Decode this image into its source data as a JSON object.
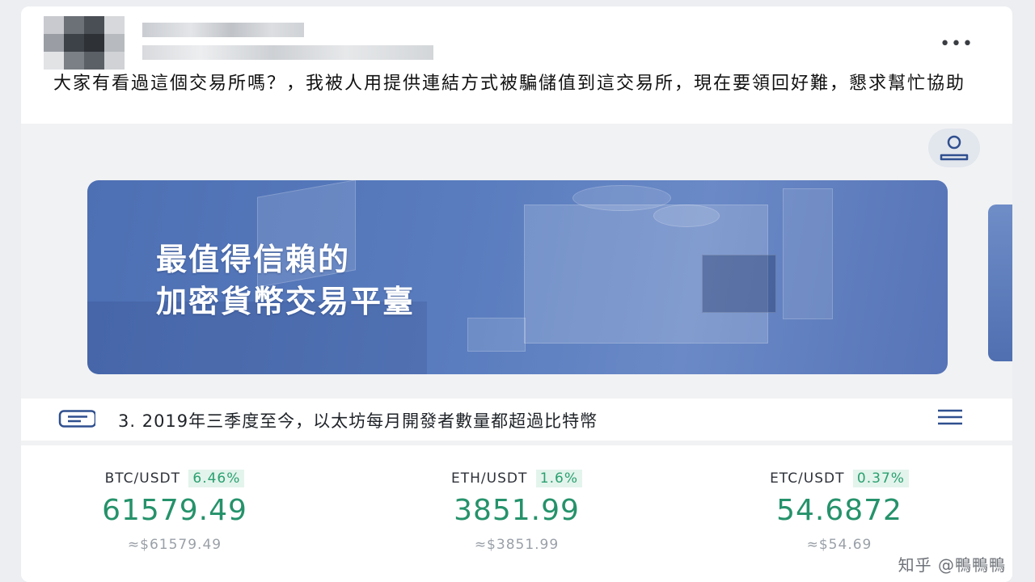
{
  "post": {
    "text": "大家有看過這個交易所嗎？，我被人用提供連結方式被騙儲值到這交易所，現在要領回好難，懇求幫忙協助",
    "more_icon": "more-horizontal-icon"
  },
  "app": {
    "user_icon": "user-icon",
    "banner": {
      "line1": "最值得信賴的",
      "line2": "加密貨幣交易平臺"
    },
    "notice": {
      "icon": "message-icon",
      "text": "3. 2019年三季度至今，以太坊每月開發者數量都超過比特幣",
      "menu_icon": "menu-icon"
    },
    "tickers": [
      {
        "pair": "BTC/USDT",
        "change": "6.46%",
        "price": "61579.49",
        "approx": "≈$61579.49"
      },
      {
        "pair": "ETH/USDT",
        "change": "1.6%",
        "price": "3851.99",
        "approx": "≈$3851.99"
      },
      {
        "pair": "ETC/USDT",
        "change": "0.37%",
        "price": "54.6872",
        "approx": "≈$54.69"
      }
    ],
    "colors": {
      "up": "#25926b",
      "up_bg": "#e3f4ec",
      "banner": "#5a7dbf"
    }
  },
  "watermark": "知乎 @鴨鴨鴨"
}
